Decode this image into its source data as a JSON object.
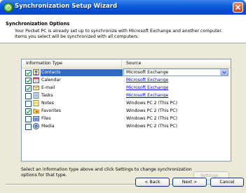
{
  "window": {
    "title": "Synchronization Setup Wizard"
  },
  "header": {
    "section_title": "Synchronization Options",
    "description": "Your Pocket PC is already set up to synchronize with Microsoft Exchange and another computer. Items you select will be synchronized with all computers."
  },
  "list": {
    "columns": [
      "Information Type",
      "Source"
    ],
    "rows": [
      {
        "checked": true,
        "icon": "contacts-icon",
        "label": "Contacts",
        "source": "Microsoft Exchange",
        "source_style": "combo",
        "selected": true
      },
      {
        "checked": true,
        "icon": "calendar-icon",
        "label": "Calendar",
        "source": "Microsoft Exchange",
        "source_style": "link"
      },
      {
        "checked": true,
        "icon": "email-icon",
        "label": "E-mail",
        "source": "Microsoft Exchange",
        "source_style": "link"
      },
      {
        "checked": false,
        "icon": "tasks-icon",
        "label": "Tasks",
        "source": "Microsoft Exchange",
        "source_style": "link"
      },
      {
        "checked": false,
        "icon": "notes-icon",
        "label": "Notes",
        "source": "Windows PC 2 (This PC)",
        "source_style": "text"
      },
      {
        "checked": true,
        "icon": "favorites-icon",
        "label": "Favorites",
        "source": "Windows PC 2 (This PC)",
        "source_style": "text"
      },
      {
        "checked": false,
        "icon": "files-icon",
        "label": "Files",
        "source": "Windows PC 2 (This PC)",
        "source_style": "text"
      },
      {
        "checked": false,
        "icon": "media-icon",
        "label": "Media",
        "source": "Windows PC 2 (This PC)",
        "source_style": "text"
      }
    ]
  },
  "hint": "Select an information type above and click Settings to change synchronization options for that type.",
  "buttons": {
    "settings": "Settings...",
    "back": "< Back",
    "next": "Next >",
    "cancel": "Cancel"
  },
  "colors": {
    "title_bar": "#0a5bd9",
    "selection": "#316ac5",
    "link": "#0000ff",
    "face": "#ece9d8"
  }
}
